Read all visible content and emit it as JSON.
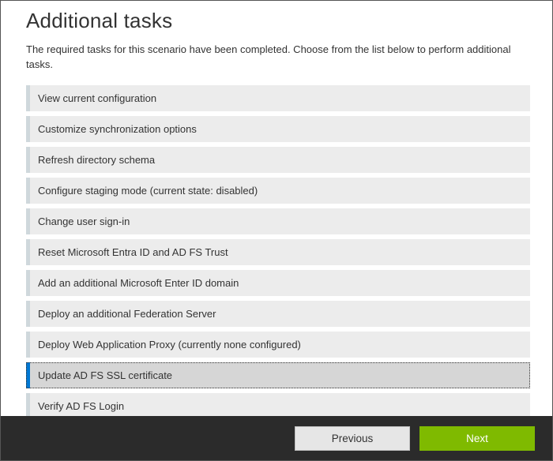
{
  "header": {
    "title": "Additional tasks",
    "description": "The required tasks for this scenario have been completed. Choose from the list below to perform additional tasks."
  },
  "tasks": [
    {
      "label": "View current configuration",
      "selected": false
    },
    {
      "label": "Customize synchronization options",
      "selected": false
    },
    {
      "label": "Refresh directory schema",
      "selected": false
    },
    {
      "label": "Configure staging mode (current state: disabled)",
      "selected": false
    },
    {
      "label": "Change user sign-in",
      "selected": false
    },
    {
      "label": "Reset Microsoft Entra ID and AD FS Trust",
      "selected": false
    },
    {
      "label": "Add an additional Microsoft Enter ID domain",
      "selected": false
    },
    {
      "label": "Deploy an additional Federation Server",
      "selected": false
    },
    {
      "label": "Deploy Web Application Proxy (currently none configured)",
      "selected": false
    },
    {
      "label": "Update AD FS SSL certificate",
      "selected": true
    },
    {
      "label": "Verify AD FS Login",
      "selected": false
    }
  ],
  "footer": {
    "previous": "Previous",
    "next": "Next"
  }
}
